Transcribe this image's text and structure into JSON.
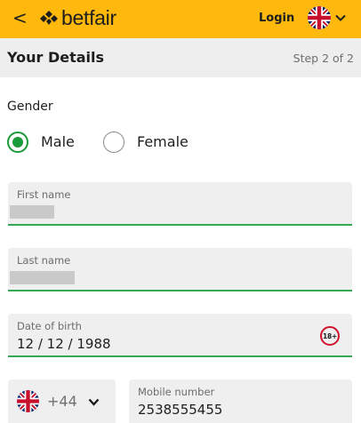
{
  "topbar": {
    "back_glyph": "<",
    "brand": "betfair",
    "login_label": "Login",
    "language_flag": "uk-flag-icon"
  },
  "header": {
    "title": "Your Details",
    "step": "Step 2 of 2"
  },
  "gender": {
    "label": "Gender",
    "options": [
      "Male",
      "Female"
    ],
    "selected": "Male"
  },
  "fields": {
    "first_name": {
      "label": "First name",
      "value": ""
    },
    "last_name": {
      "label": "Last name",
      "value": ""
    },
    "dob": {
      "label": "Date of birth",
      "value": "12 / 12 / 1988",
      "badge": "18+"
    },
    "phone_code": {
      "value": "+44",
      "flag": "uk-flag-icon"
    },
    "mobile": {
      "label": "Mobile number",
      "value": "2538555455"
    }
  },
  "colors": {
    "brand_yellow": "#ffb80c",
    "accent_green": "#1a9a3a",
    "badge_red": "#d0122c",
    "field_bg": "#efefef"
  }
}
